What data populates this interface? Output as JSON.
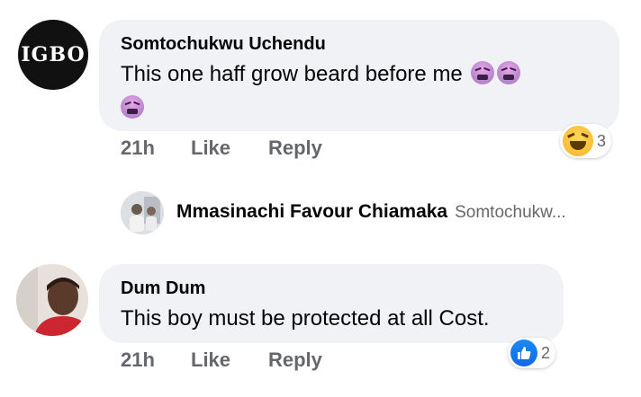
{
  "comments": [
    {
      "author": "Somtochukwu Uchendu",
      "avatar_text": "IGBO",
      "text": "This one haff grow beard before me",
      "emojis": [
        "tired-face-emoji",
        "tired-face-emoji",
        "tired-face-emoji"
      ],
      "time": "21h",
      "like_label": "Like",
      "reply_label": "Reply",
      "reaction": {
        "icon": "haha-reaction",
        "count": "3"
      }
    },
    {
      "author": "Dum Dum",
      "text": "This boy must be protected at all Cost.",
      "time": "21h",
      "like_label": "Like",
      "reply_label": "Reply",
      "reaction": {
        "icon": "like-reaction",
        "count": "2"
      }
    }
  ],
  "reply_preview": {
    "author": "Mmasinachi Favour Chiamaka",
    "snippet": "Somtochukw..."
  },
  "colors": {
    "bubble": "#f0f2f5",
    "meta_text": "#65676b",
    "like_blue": "#1877f2"
  }
}
